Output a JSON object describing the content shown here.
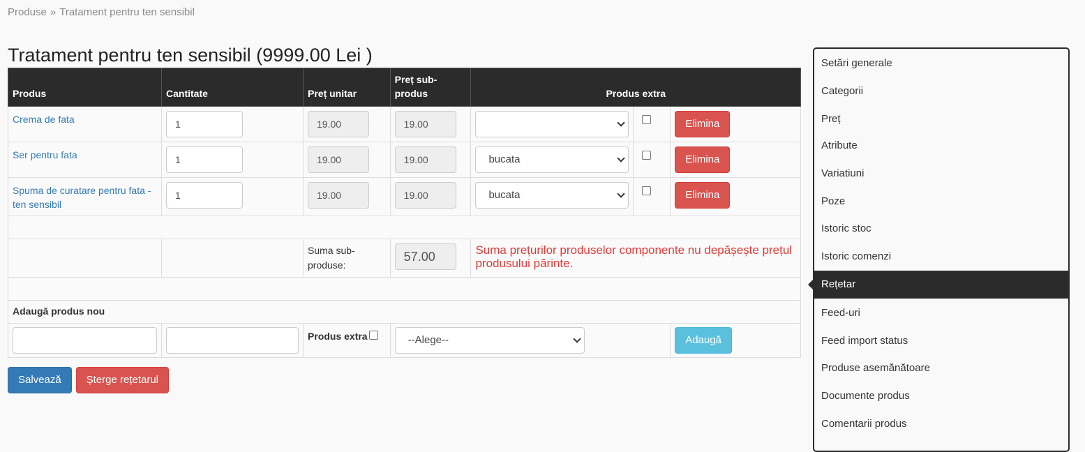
{
  "breadcrumb": {
    "root": "Produse",
    "separator": "»",
    "current": "Tratament pentru ten sensibil"
  },
  "page_title": "Tratament pentru ten sensibil (9999.00 Lei )",
  "table": {
    "headers": {
      "product": "Produs",
      "quantity": "Cantitate",
      "unit_price": "Preț unitar",
      "sub_price": "Preț sub-produs",
      "extra": "Produs extra"
    },
    "rows": [
      {
        "name": "Crema de fata",
        "qty": "1",
        "unit_price": "19.00",
        "sub_price": "19.00",
        "unit": "",
        "remove_label": "Elimina"
      },
      {
        "name": "Ser pentru fata",
        "qty": "1",
        "unit_price": "19.00",
        "sub_price": "19.00",
        "unit": "bucata",
        "remove_label": "Elimina"
      },
      {
        "name": "Spuma de curatare pentru fata - ten sensibil",
        "qty": "1",
        "unit_price": "19.00",
        "sub_price": "19.00",
        "unit": "bucata",
        "remove_label": "Elimina"
      }
    ],
    "sum_label": "Suma sub-produse:",
    "sum_value": "57.00",
    "warning": "Suma prețurilor produselor componente nu depășește prețul produsului părinte."
  },
  "add_section": {
    "title": "Adaugă produs nou",
    "product_value": "",
    "qty_value": "",
    "extra_label": "Produs extra",
    "unit_select": "--Alege--",
    "add_label": "Adaugă"
  },
  "actions": {
    "save_label": "Salvează",
    "delete_label": "Șterge rețetarul"
  },
  "sidebar": {
    "items": [
      {
        "label": "Setări generale"
      },
      {
        "label": "Categorii"
      },
      {
        "label": "Preț"
      },
      {
        "label": "Atribute"
      },
      {
        "label": "Variatiuni"
      },
      {
        "label": "Poze"
      },
      {
        "label": "Istoric stoc"
      },
      {
        "label": "Istoric comenzi"
      },
      {
        "label": "Rețetar",
        "active": true
      },
      {
        "label": "Feed-uri"
      },
      {
        "label": "Feed import status"
      },
      {
        "label": "Produse asemănătoare"
      },
      {
        "label": "Documente produs"
      },
      {
        "label": "Comentarii produs"
      }
    ]
  },
  "colors": {
    "danger": "#d9534f",
    "info": "#5bc0de",
    "primary": "#337ab7",
    "header_bg": "#2b2b2b",
    "warning_text": "#e53935",
    "link": "#337ab7"
  }
}
